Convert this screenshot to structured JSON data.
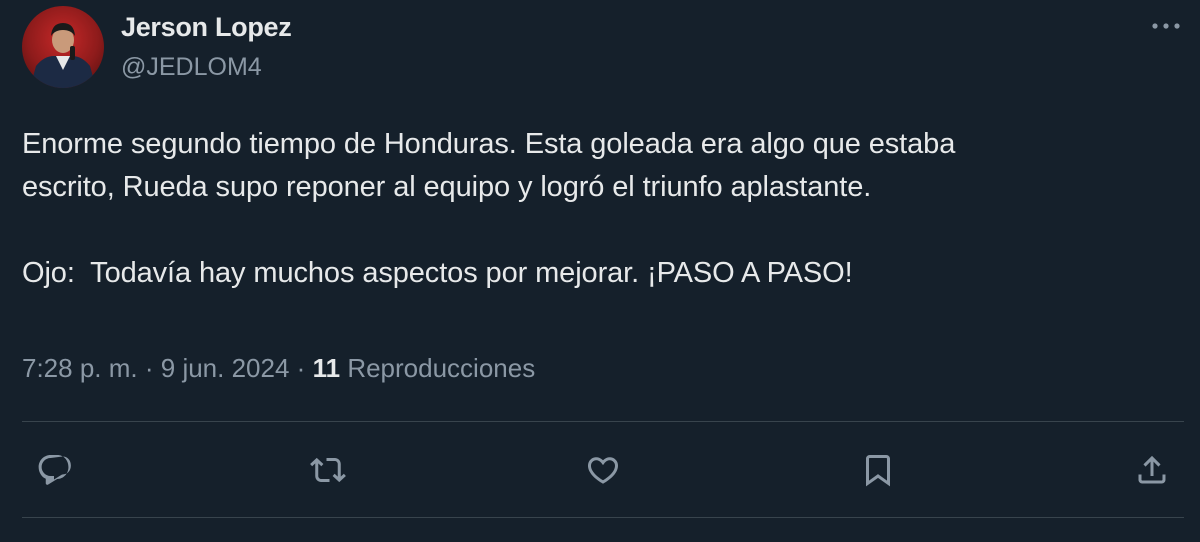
{
  "author": {
    "name": "Jerson Lopez",
    "handle": "@JEDLOM4"
  },
  "tweet": {
    "paragraph_1_line_1": "Enorme segundo tiempo de Honduras. Esta goleada era algo que estaba",
    "paragraph_1_line_2": "escrito, Rueda supo reponer al equipo y logró el triunfo aplastante.",
    "paragraph_2": "Ojo:  Todavía hay muchos aspectos por mejorar. ¡PASO A PASO!"
  },
  "meta": {
    "time": "7:28 p. m.",
    "separator": "·",
    "date": "9 jun. 2024",
    "views_count": "11",
    "views_label": "Reproducciones"
  },
  "icons": {
    "more": "more-dots-icon",
    "reply": "reply-icon",
    "retweet": "retweet-icon",
    "like": "heart-icon",
    "bookmark": "bookmark-icon",
    "share": "share-icon"
  },
  "colors": {
    "background": "#15202b",
    "primary_text": "#e7e9ea",
    "secondary_text": "#8b98a5",
    "divider": "#38444d"
  }
}
